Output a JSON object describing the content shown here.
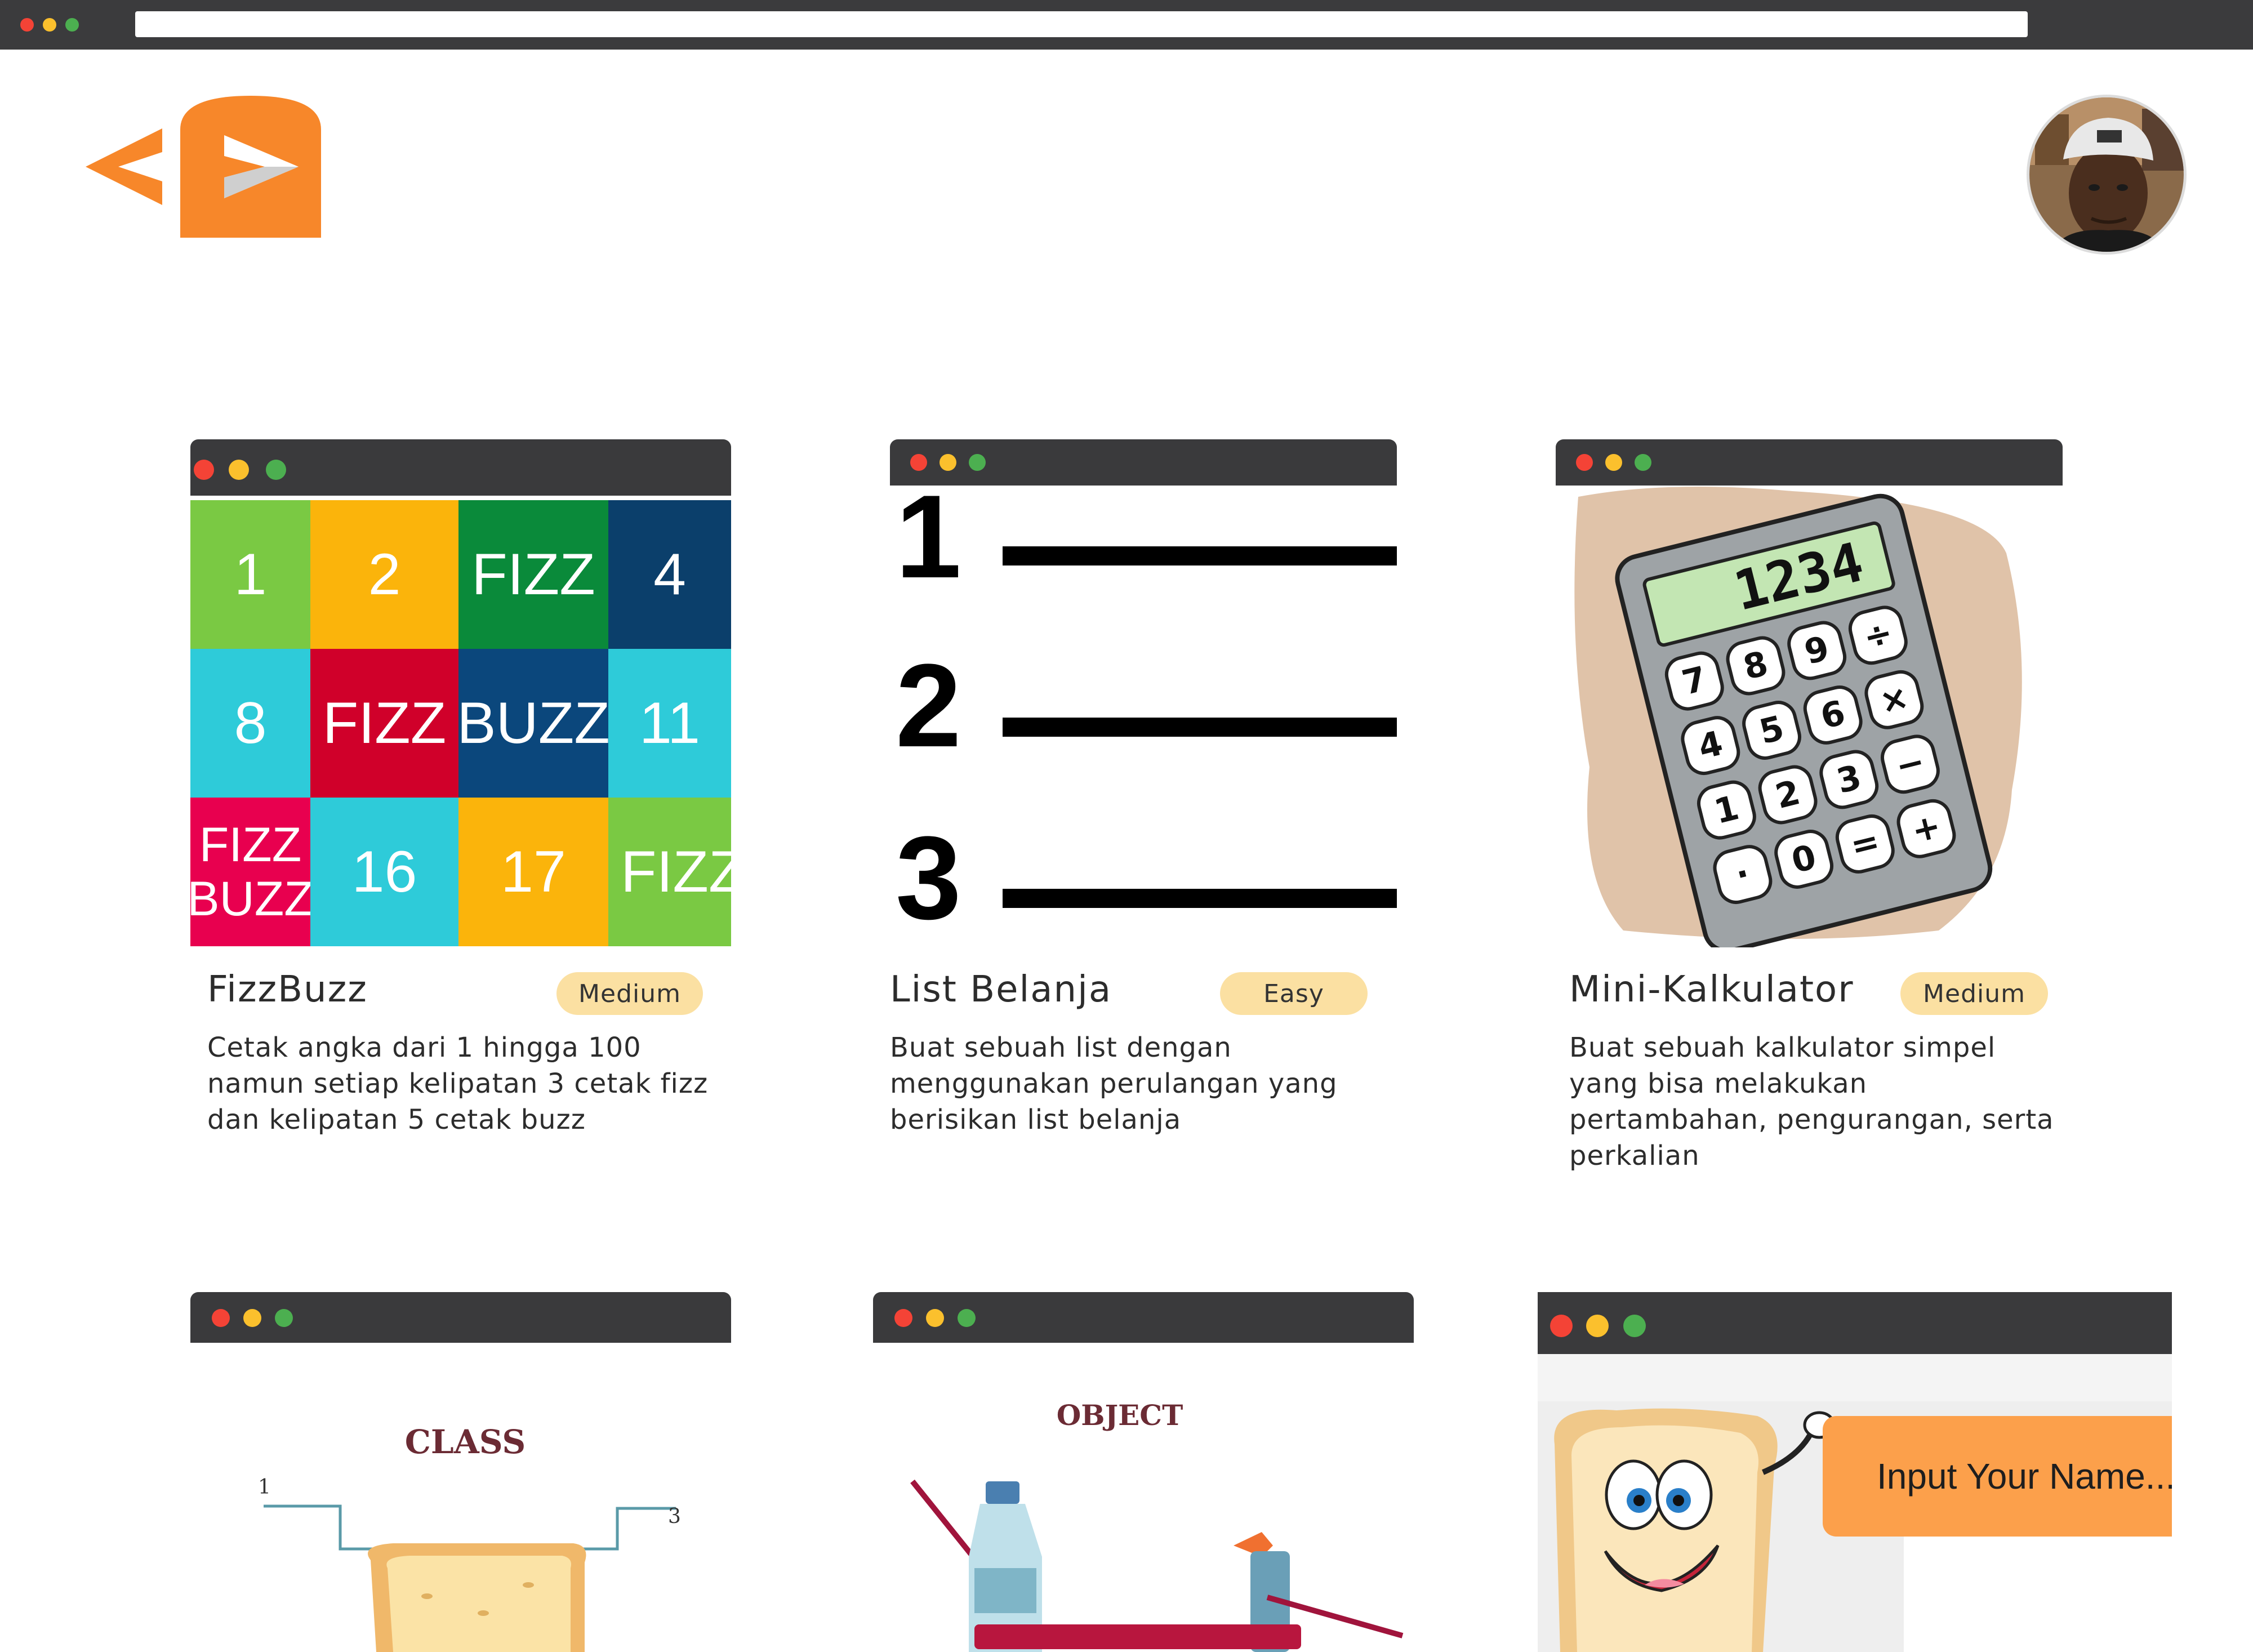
{
  "colors": {
    "brand_orange": "#f7872a",
    "badge_bg": "#fbe0a2",
    "window_bar": "#3a3a3c",
    "dot_red": "#f44336",
    "dot_yellow": "#fbc02d",
    "dot_green": "#4caf50"
  },
  "header": {
    "logo_icon": "code-bread-logo",
    "avatar_icon": "user-avatar"
  },
  "cards": [
    {
      "title": "FizzBuzz",
      "difficulty": "Medium",
      "description": "Cetak angka dari 1 hingga 100 namun setiap kelipatan 3 cetak fizz dan kelipatan 5 cetak buzz",
      "thumb": {
        "cells": [
          "1",
          "2",
          "FIZZ",
          "4",
          "8",
          "FIZZ",
          "BUZZ",
          "11",
          "FIZZ BUZZ",
          "16",
          "17",
          "FIZZ"
        ]
      }
    },
    {
      "title": "List Belanja",
      "difficulty": "Easy",
      "description": "Buat sebuah list dengan menggunakan perulangan yang berisikan list belanja",
      "thumb": {
        "numbers": [
          "1",
          "2",
          "3"
        ]
      }
    },
    {
      "title": "Mini-Kalkulator",
      "difficulty": "Medium",
      "description": "Buat sebuah kalkulator simpel yang bisa melakukan pertambahan, pengurangan, serta perkalian",
      "thumb": {
        "display": "1234",
        "keys": [
          "7",
          "8",
          "9",
          "÷",
          "4",
          "5",
          "6",
          "×",
          "1",
          "2",
          "3",
          "−",
          "·",
          "0",
          "=",
          "+"
        ]
      }
    },
    {
      "thumb": {
        "heading": "CLASS",
        "label_left": "1",
        "label_right": "3"
      }
    },
    {
      "thumb": {
        "heading": "OBJECT"
      }
    },
    {
      "thumb": {
        "input_text": "Input Your Name..."
      }
    }
  ]
}
